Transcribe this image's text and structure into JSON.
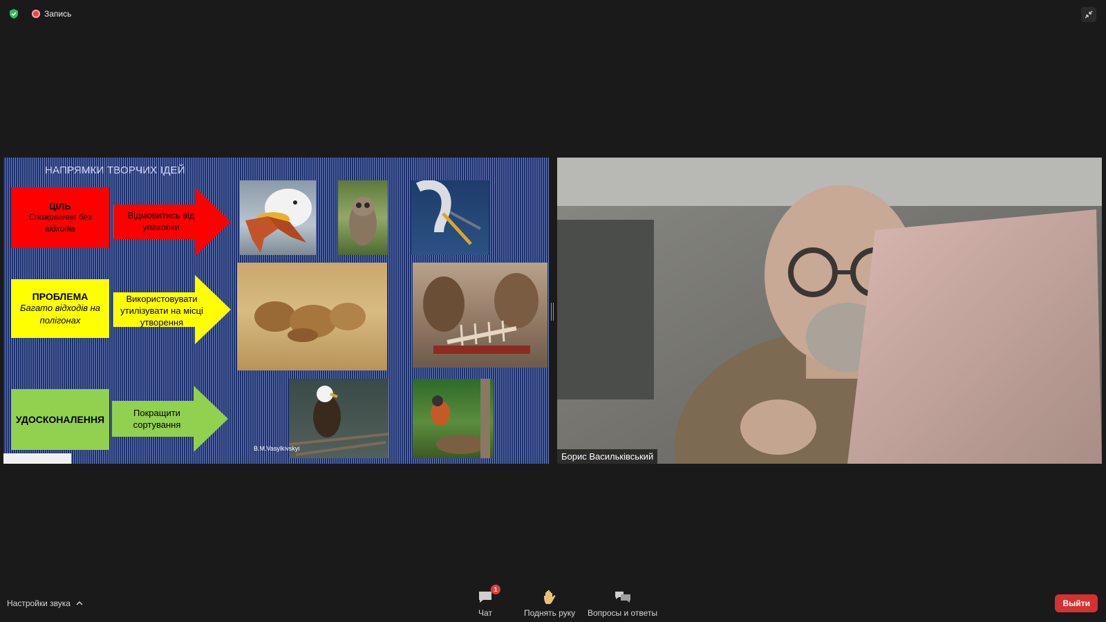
{
  "top_bar": {
    "recording_label": "Запись"
  },
  "slide": {
    "title": "НАПРЯМКИ ТВОРЧИХ ІДЕЙ",
    "rows": [
      {
        "box_title": "ЦІЛЬ",
        "box_text": "Споживання без відходів",
        "box_color": "#ff0000",
        "arrow_text": "Відмовитись від упаковки",
        "arrow_color": "#ff0000"
      },
      {
        "box_title": "ПРОБЛЕМА",
        "box_text": "Багато відходів на полігонах",
        "box_color": "#ffff00",
        "arrow_text": "Використовувати утилізувати на місці утворення",
        "arrow_color": "#ffff00"
      },
      {
        "box_title": "УДОСКОНАЛЕННЯ",
        "box_text": "",
        "box_color": "#92d050",
        "arrow_text": "Покращити сортування",
        "arrow_color": "#92d050"
      }
    ],
    "credit": "B.M.Vasylkivskyi"
  },
  "video": {
    "participant_name": "Борис Васильківський"
  },
  "toolbar": {
    "audio_settings_label": "Настройки звука",
    "chat_label": "Чат",
    "chat_badge": "1",
    "raise_hand_label": "Поднять руку",
    "qa_label": "Вопросы и ответы",
    "leave_label": "Выйти"
  },
  "colors": {
    "leave_button": "#d33232",
    "badge": "#e23c3c",
    "shield": "#2dbb63"
  }
}
